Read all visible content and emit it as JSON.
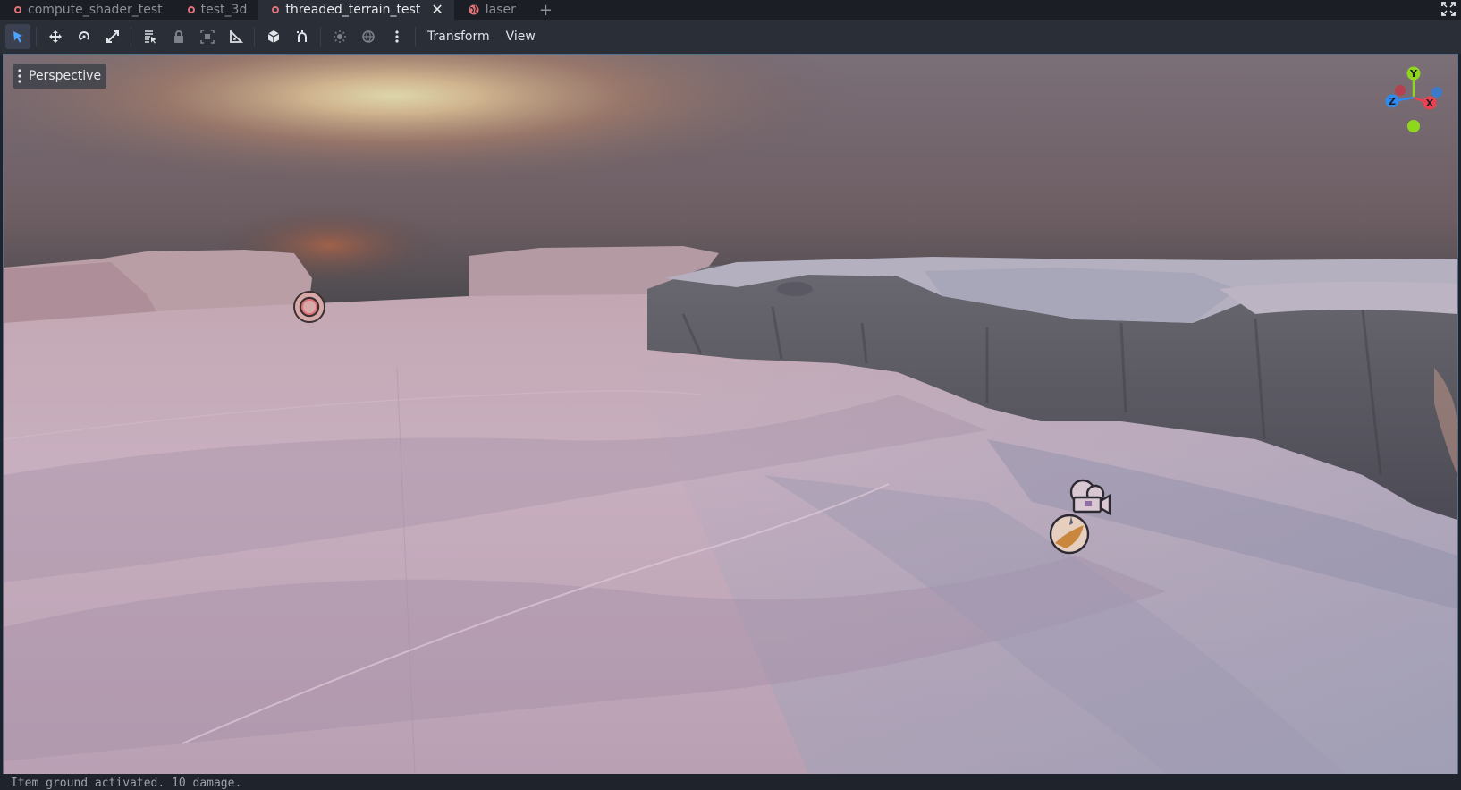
{
  "tabs": [
    {
      "label": "compute_shader_test",
      "icon": "scene-circle-icon",
      "active": false
    },
    {
      "label": "test_3d",
      "icon": "scene-circle-icon",
      "active": false
    },
    {
      "label": "threaded_terrain_test",
      "icon": "scene-circle-icon",
      "active": true
    },
    {
      "label": "laser",
      "icon": "globe-icon",
      "active": false
    }
  ],
  "tab_add_label": "+",
  "tab_close_label": "✕",
  "toolbar": {
    "tools": [
      "select-icon",
      "move-icon",
      "rotate-icon",
      "scale-icon",
      "list-select-icon",
      "lock-icon",
      "group-icon",
      "ruler-icon",
      "local-space-icon",
      "snap-icon",
      "sun-preview-icon",
      "environment-preview-icon",
      "more-icon"
    ],
    "menus": {
      "transform": "Transform",
      "view": "View"
    }
  },
  "viewport": {
    "mode_label": "Perspective",
    "gizmo": {
      "y": "Y",
      "x": "X",
      "z": "Z"
    }
  },
  "output_line": "Item ground activated. 10 damage.",
  "colors": {
    "accent": "#4aa3ff",
    "tab_icon": "#e0737a",
    "gizmo_x": "#f0404f",
    "gizmo_y": "#8fd61e",
    "gizmo_z": "#2f8bf0"
  }
}
